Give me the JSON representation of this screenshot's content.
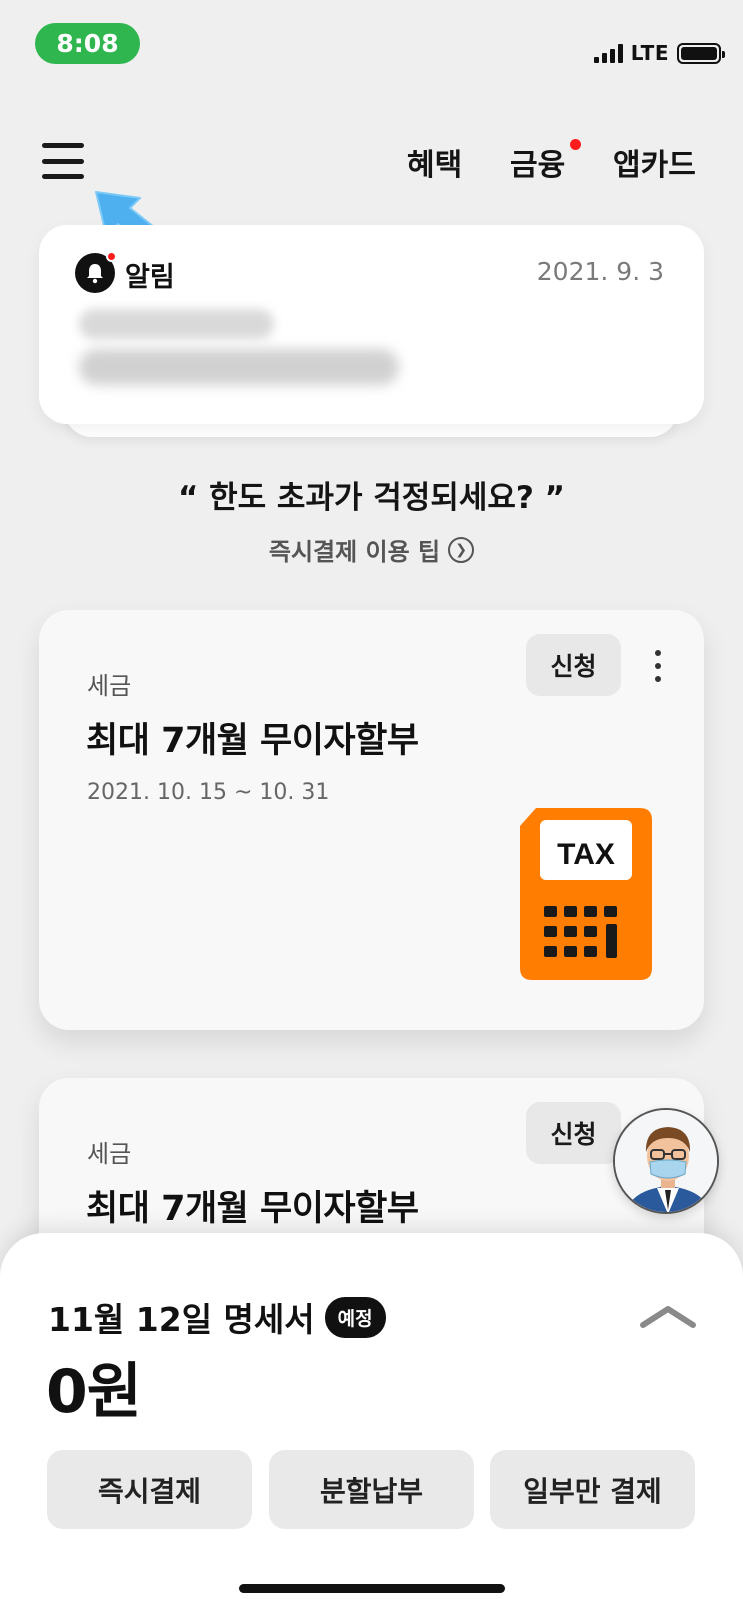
{
  "status_bar": {
    "time": "8:08",
    "network": "LTE"
  },
  "header": {
    "nav": [
      "혜택",
      "금융",
      "앱카드"
    ]
  },
  "notice": {
    "title": "알림",
    "date": "2021. 9. 3"
  },
  "quote": {
    "text": "“ 한도 초과가 걱정되세요? ”",
    "tip": "즉시결제 이용 팁"
  },
  "promos": [
    {
      "category": "세금",
      "title": "최대 7개월 무이자할부",
      "period": "2021. 10. 15 ~ 10. 31",
      "apply_label": "신청",
      "image_label": "TAX"
    },
    {
      "category": "세금",
      "title": "최대 7개월 무이자할부",
      "apply_label": "신청"
    }
  ],
  "statement": {
    "title": "11월 12일 명세서",
    "badge": "예정",
    "amount": "0원"
  },
  "actions": [
    "즉시결제",
    "분할납부",
    "일부만 결제"
  ],
  "colors": {
    "status_pill": "#2fb64f",
    "tax_orange": "#ff7d00",
    "notification_dot": "#ff1c1c",
    "pointer_arrow": "#4fb0f0"
  }
}
